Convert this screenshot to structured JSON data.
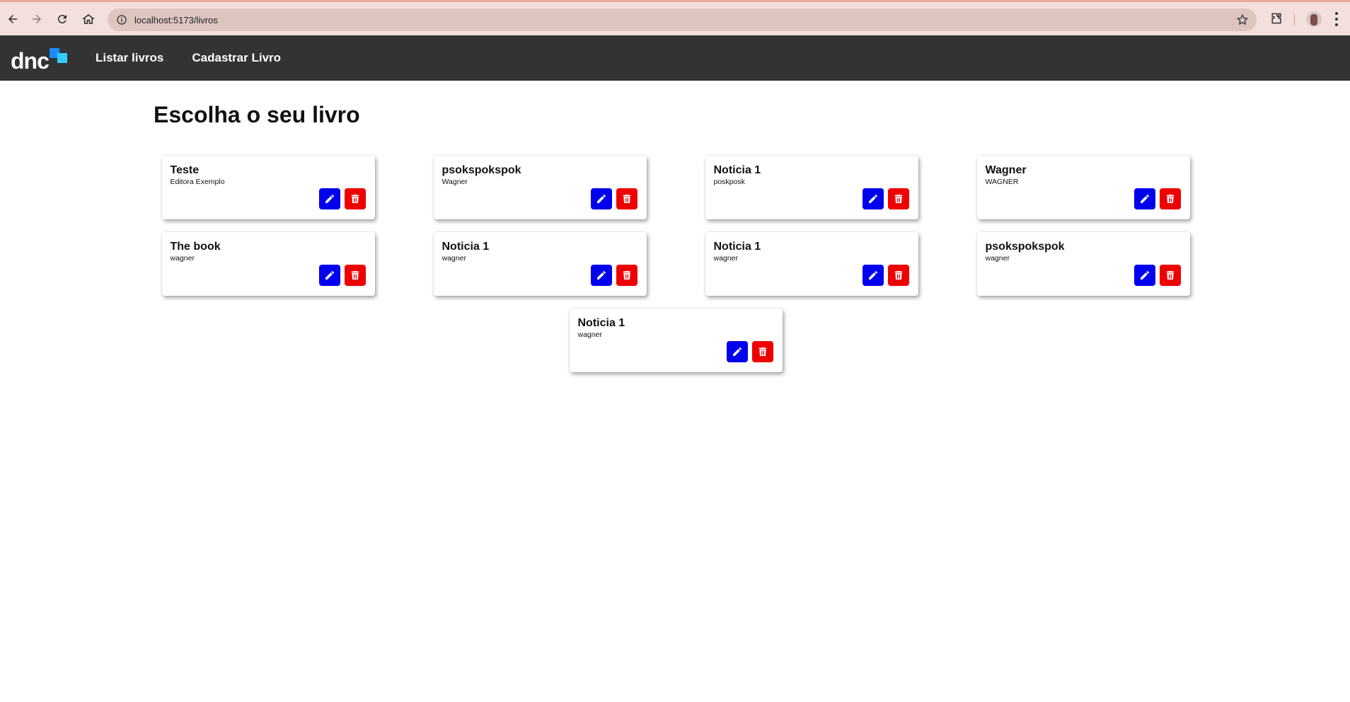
{
  "browser": {
    "url": "localhost:5173/livros",
    "icons": {
      "back": "arrow-left-icon",
      "forward": "arrow-right-icon",
      "reload": "reload-icon",
      "home": "home-icon",
      "site_info": "info-icon",
      "bookmark": "star-icon",
      "extensions": "puzzle-icon",
      "profile": "avatar",
      "menu": "kebab-menu-icon"
    }
  },
  "header": {
    "logo_text": "dnc",
    "nav": [
      {
        "label": "Listar livros"
      },
      {
        "label": "Cadastrar Livro"
      }
    ],
    "colors": {
      "background": "#333333",
      "logo_accent_1": "#1a8cff",
      "logo_accent_2": "#33ccff"
    }
  },
  "main": {
    "title": "Escolha o seu livro",
    "books": [
      {
        "title": "Teste",
        "publisher": "Editora Exemplo"
      },
      {
        "title": "psokspokspok",
        "publisher": "Wagner"
      },
      {
        "title": "Noticia 1",
        "publisher": "poskposk"
      },
      {
        "title": "Wagner",
        "publisher": "WAGNER"
      },
      {
        "title": "The book",
        "publisher": "wagner"
      },
      {
        "title": "Noticia 1",
        "publisher": "wagner"
      },
      {
        "title": "Noticia 1",
        "publisher": "wagner"
      },
      {
        "title": "psokspokspok",
        "publisher": "wagner"
      },
      {
        "title": "Noticia 1",
        "publisher": "wagner"
      }
    ],
    "actions": {
      "edit_icon": "pencil-icon",
      "delete_icon": "trash-icon",
      "edit_color": "#0000ee",
      "delete_color": "#ee0000"
    }
  }
}
